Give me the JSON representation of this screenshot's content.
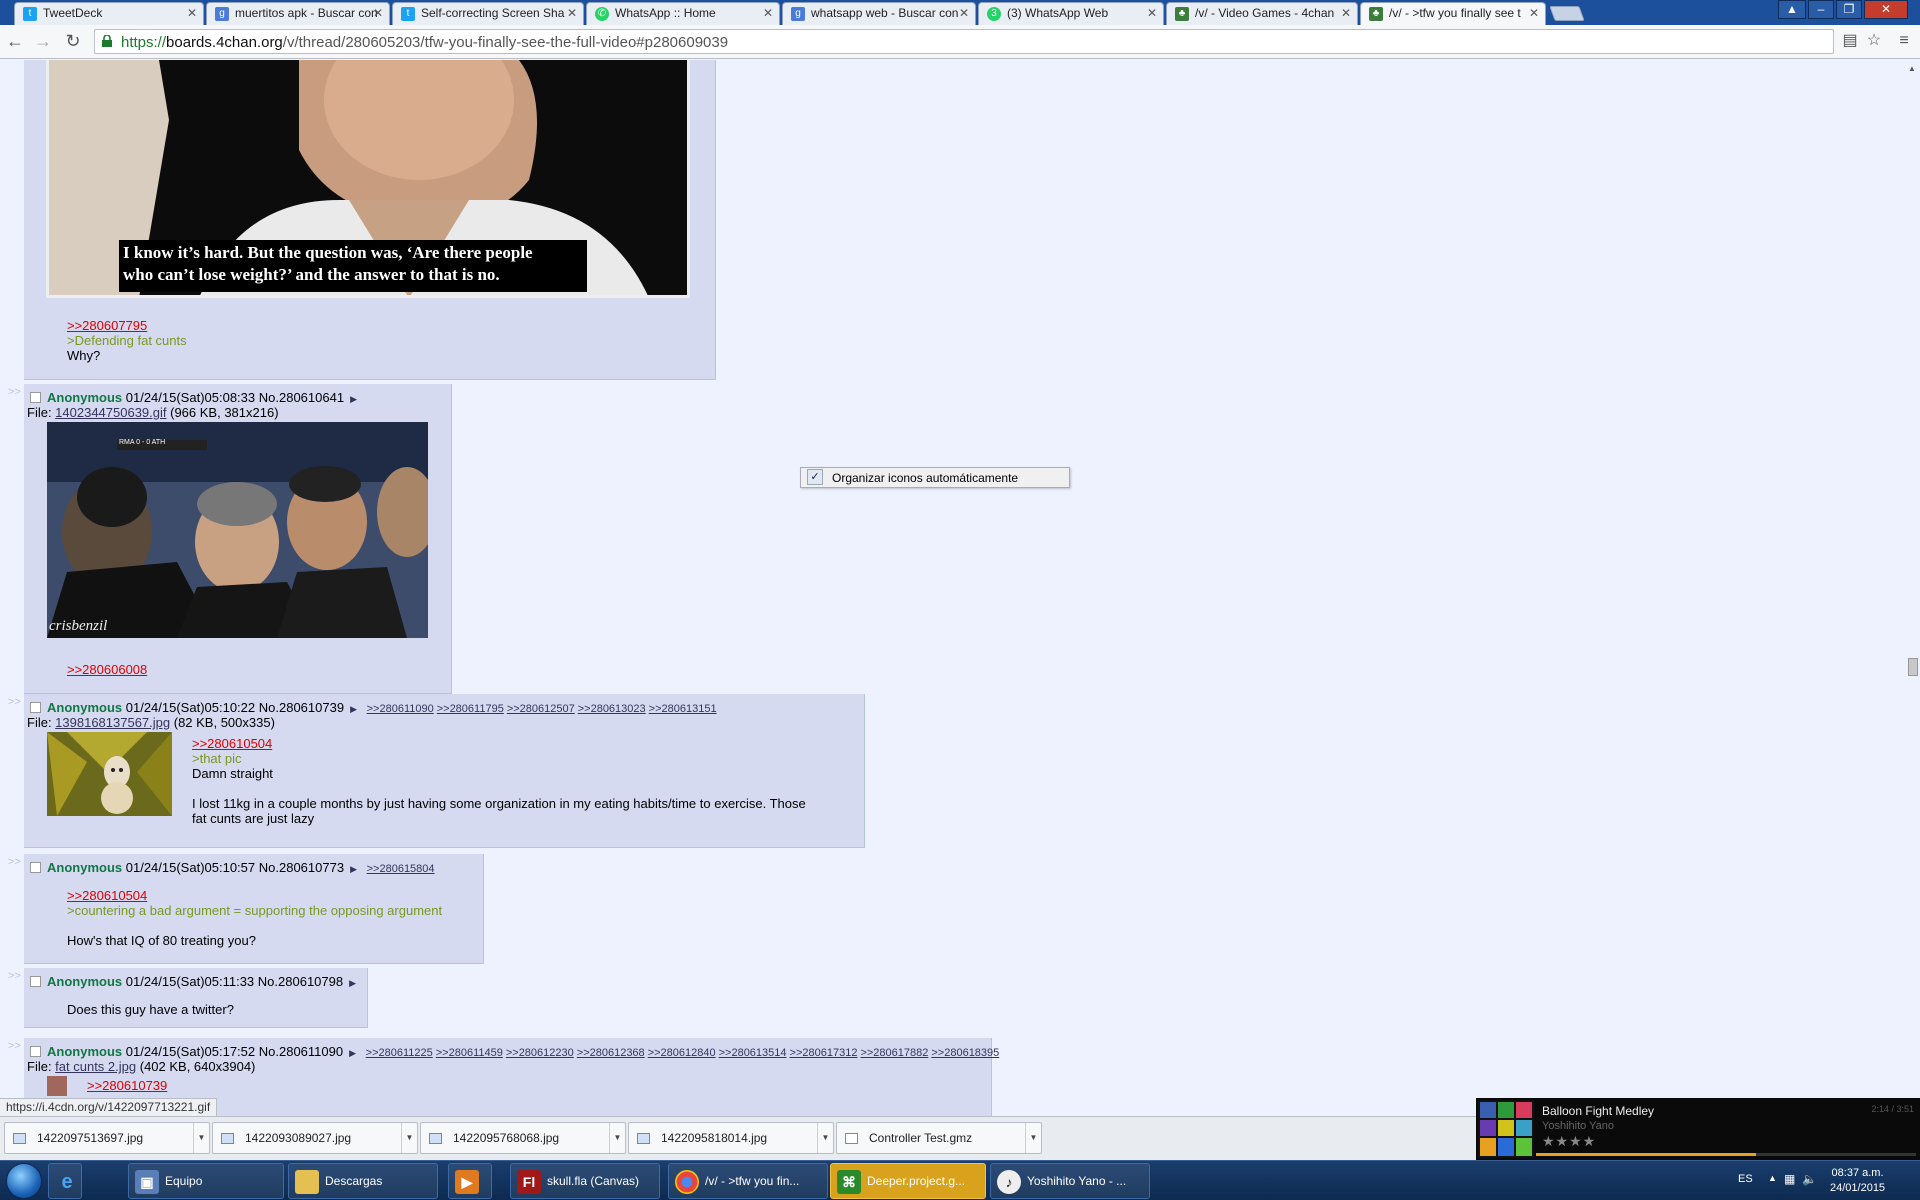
{
  "tabs": [
    {
      "label": "TweetDeck",
      "icon": "twitter-bird-icon",
      "color": "#1da1f2"
    },
    {
      "label": "muertitos apk - Buscar con",
      "icon": "google-icon",
      "color": "#4a7bd8"
    },
    {
      "label": "Self-correcting Screen Sha",
      "icon": "twitter-bird-icon",
      "color": "#1da1f2"
    },
    {
      "label": "WhatsApp :: Home",
      "icon": "whatsapp-icon",
      "color": "#25d366"
    },
    {
      "label": "whatsapp web - Buscar con",
      "icon": "google-icon",
      "color": "#4a7bd8"
    },
    {
      "label": "(3) WhatsApp Web",
      "icon": "whatsapp-icon",
      "color": "#25d366"
    },
    {
      "label": "/v/ - Video Games - 4chan",
      "icon": "clover-icon",
      "color": "#3b7d3b"
    },
    {
      "label": "/v/ - >tfw you finally see t",
      "icon": "clover-icon",
      "color": "#3b7d3b"
    }
  ],
  "url": {
    "scheme": "https://",
    "host": "boards.4chan.org",
    "path": "/v/thread/280605203/tfw-you-finally-see-the-full-video#p280609039"
  },
  "posts": {
    "top": {
      "caption_line1": "I know it’s hard. But the question was, ‘Are there people",
      "caption_line2": "who can’t lose weight?’ and the answer to that is no.",
      "quote": ">>280607795",
      "green": ">Defending fat cunts",
      "text": "Why?"
    },
    "p1": {
      "name": "Anonymous",
      "date": "01/24/15(Sat)05:08:33",
      "no": "No.280610641",
      "file_prefix": "File: ",
      "file_link": "1402344750639.gif",
      "file_meta": " (966 KB, 381x216)",
      "thumb_text": "crisbenzil",
      "thumb_score": "RMA 0 - 0 ATH",
      "quote": ">>280606008"
    },
    "p2": {
      "name": "Anonymous",
      "date": "01/24/15(Sat)05:10:22",
      "no": "No.280610739",
      "backlinks": [
        ">>280611090",
        ">>280611795",
        ">>280612507",
        ">>280613023",
        ">>280613151"
      ],
      "file_prefix": "File: ",
      "file_link": "1398168137567.jpg",
      "file_meta": " (82 KB, 500x335)",
      "quote": ">>280610504",
      "green": ">that pic",
      "line1": "Damn straight",
      "line2": "I lost 11kg in a couple months by just having some organization in my eating habits/time to exercise. Those",
      "line3": "fat cunts are just lazy"
    },
    "p3": {
      "name": "Anonymous",
      "date": "01/24/15(Sat)05:10:57",
      "no": "No.280610773",
      "backlinks": [
        ">>280615804"
      ],
      "quote": ">>280610504",
      "green": ">countering a bad argument = supporting the opposing argument",
      "text": "How's that IQ of 80 treating you?"
    },
    "p4": {
      "name": "Anonymous",
      "date": "01/24/15(Sat)05:11:33",
      "no": "No.280610798",
      "text": "Does this guy have a twitter?"
    },
    "p5": {
      "name": "Anonymous",
      "date": "01/24/15(Sat)05:17:52",
      "no": "No.280611090",
      "backlinks": [
        ">>280611225",
        ">>280611459",
        ">>280612230",
        ">>280612368",
        ">>280612840",
        ">>280613514",
        ">>280617312",
        ">>280617882",
        ">>280618395"
      ],
      "file_prefix": "File: ",
      "file_link": "fat cunts 2.jpg",
      "file_meta": " (402 KB, 640x3904)",
      "quote": ">>280610739"
    }
  },
  "context_menu": {
    "label": "Organizar iconos automáticamente",
    "checked": true
  },
  "status_url": "https://i.4cdn.org/v/1422097713221.gif",
  "downloads": [
    "1422097513697.jpg",
    "1422093089027.jpg",
    "1422095768068.jpg",
    "1422095818014.jpg",
    "Controller Test.gmz"
  ],
  "media": {
    "title": "Balloon Fight Medley",
    "artist": "Yoshihito Yano",
    "time": "2:14 / 3:51",
    "stars": "★★★★",
    "progress": 0.58
  },
  "taskbar": {
    "items": [
      {
        "label": "Equipo",
        "icon": "computer-icon"
      },
      {
        "label": "Descargas",
        "icon": "folder-icon"
      },
      {
        "label": "",
        "icon": "media-player-icon"
      },
      {
        "label": "skull.fla (Canvas)",
        "icon": "flash-icon"
      },
      {
        "label": "/v/ - >tfw you fin...",
        "icon": "chrome-icon"
      },
      {
        "label": "Deeper.project.g...",
        "icon": "gamemaker-icon"
      },
      {
        "label": "Yoshihito Yano - ...",
        "icon": "music-player-icon"
      }
    ],
    "lang": "ES",
    "time": "08:37 a.m.",
    "date": "24/01/2015"
  }
}
